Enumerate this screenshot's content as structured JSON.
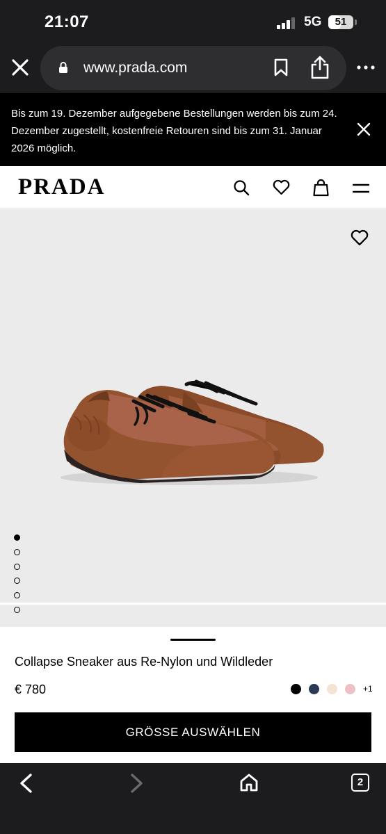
{
  "status_bar": {
    "time": "21:07",
    "network": "5G",
    "battery_level": "51",
    "battery_fraction": 0.51
  },
  "browser": {
    "url": "www.prada.com",
    "open_tabs": "2",
    "icons": [
      "close-icon",
      "lock-icon",
      "bookmark-icon",
      "share-icon",
      "more-icon",
      "back-icon",
      "forward-icon",
      "home-icon",
      "tabs-icon"
    ]
  },
  "banner": {
    "text": "Bis zum 19. Dezember aufgegebene Bestellungen werden bis zum 24. Dezember zugestellt, kostenfreie Retouren sind bis zum 31. Januar 2026 möglich."
  },
  "header": {
    "logo": "PRADA",
    "icons": [
      "search-icon",
      "heart-icon",
      "shopping-bag-icon",
      "menu-icon"
    ]
  },
  "gallery": {
    "image_count": 6,
    "active_index": 0,
    "background": "#ebebeb"
  },
  "product": {
    "name": "Collapse Sneaker aus Re-Nylon und Wildleder",
    "price": "€ 780",
    "colors": [
      "#000000",
      "#2b3a55",
      "#f3e4d3",
      "#eec1c7"
    ],
    "more_colors_label": "+1",
    "cta_label": "GRÖSSE AUSWÄHLEN"
  }
}
